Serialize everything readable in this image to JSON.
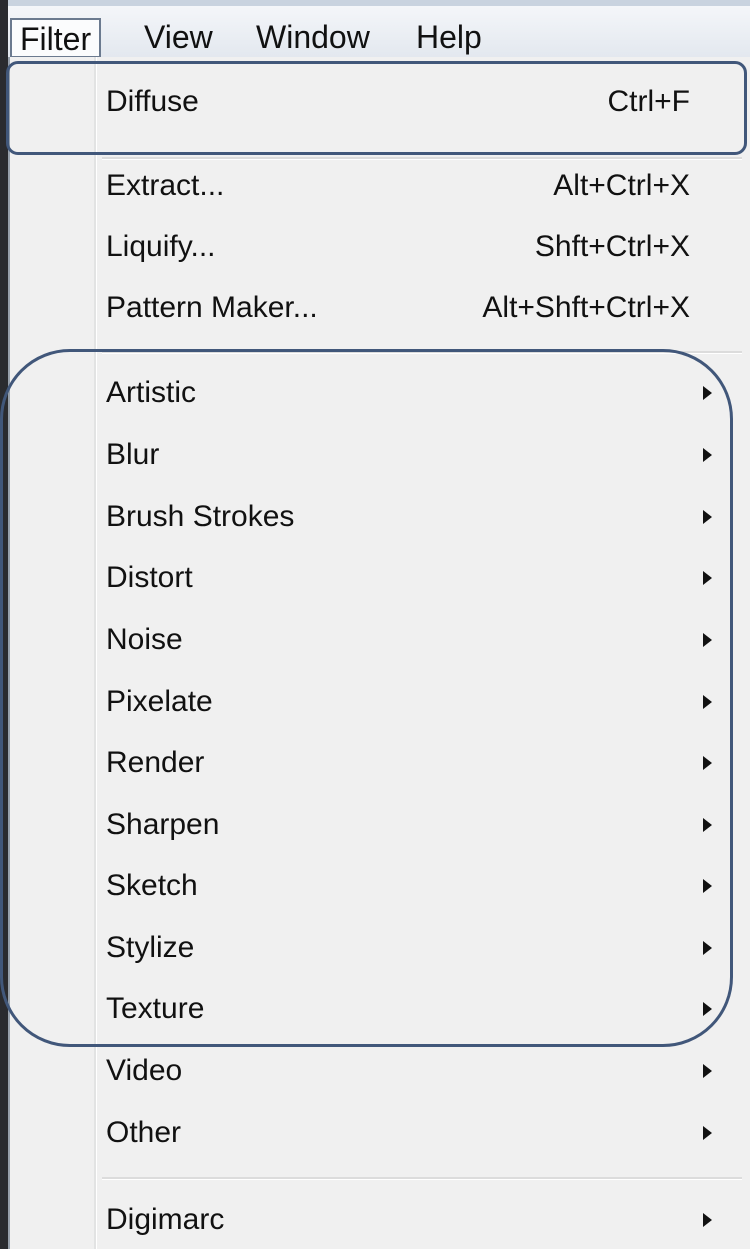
{
  "menubar": {
    "items": [
      {
        "label": "Filter",
        "active": true
      },
      {
        "label": "View"
      },
      {
        "label": "Window"
      },
      {
        "label": "Help"
      }
    ]
  },
  "menu": {
    "diffuse": {
      "label": "Diffuse",
      "shortcut": "Ctrl+F"
    },
    "extract": {
      "label": "Extract...",
      "shortcut": "Alt+Ctrl+X"
    },
    "liquify": {
      "label": "Liquify...",
      "shortcut": "Shft+Ctrl+X"
    },
    "pattern_maker": {
      "label": "Pattern Maker...",
      "shortcut": "Alt+Shft+Ctrl+X"
    },
    "submenus": [
      "Artistic",
      "Blur",
      "Brush Strokes",
      "Distort",
      "Noise",
      "Pixelate",
      "Render",
      "Sharpen",
      "Sketch",
      "Stylize",
      "Texture",
      "Video",
      "Other"
    ],
    "digimarc": "Digimarc"
  },
  "colors": {
    "menu_bg": "#f0f0f0",
    "highlight_outline": "#41577a",
    "page_bg": "#1e1f23"
  }
}
